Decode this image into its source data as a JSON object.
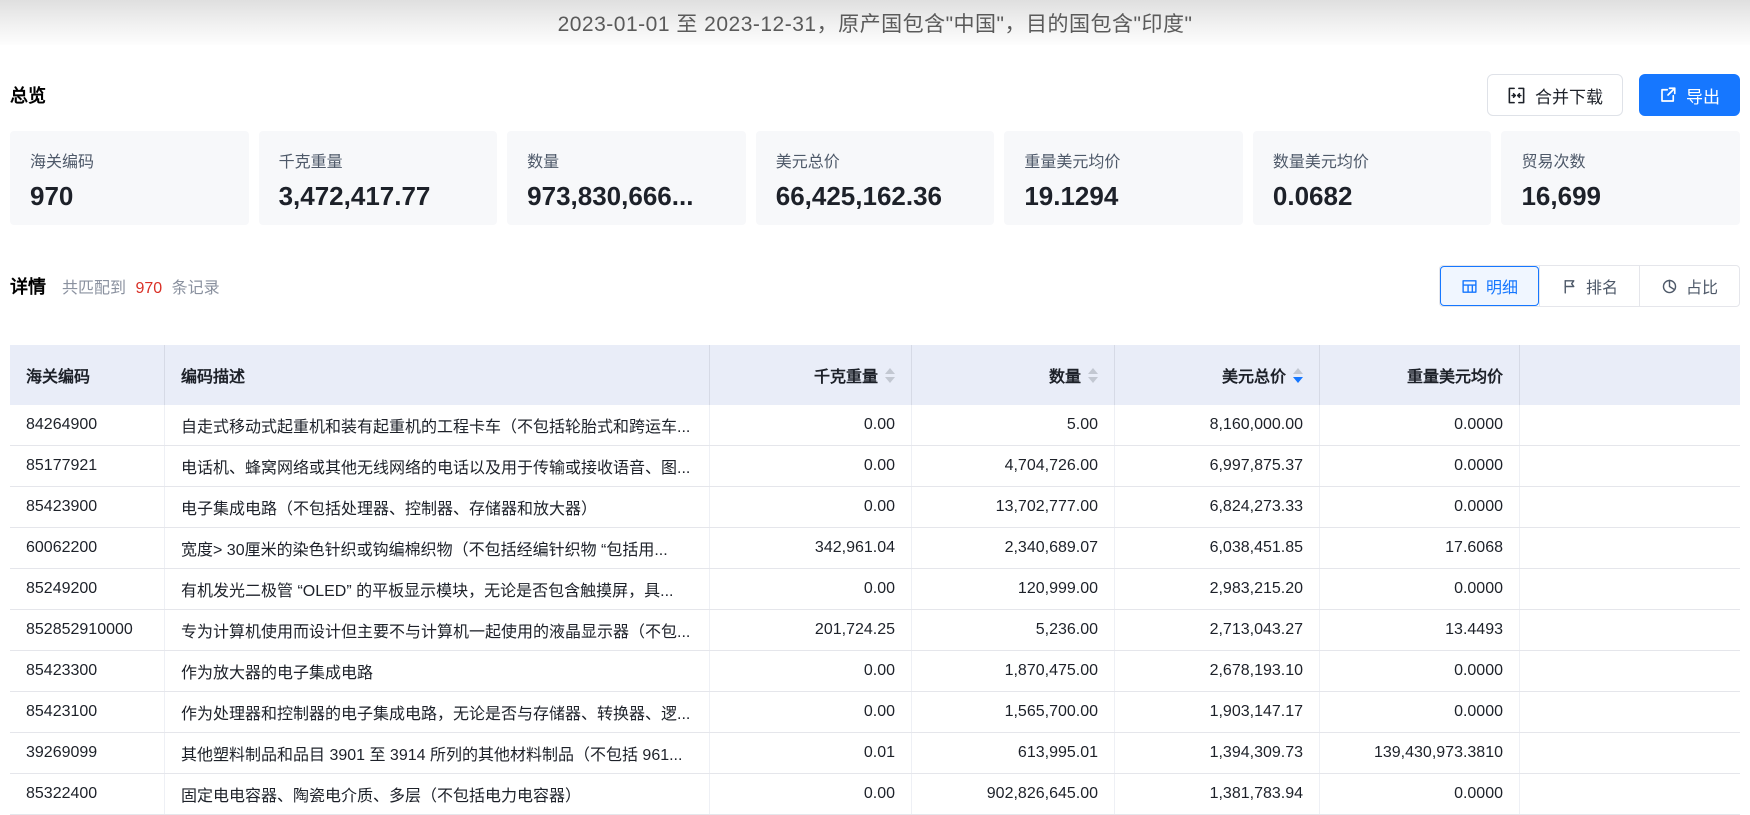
{
  "colors": {
    "accent": "#1677ff",
    "red": "#d93026",
    "table_header_bg": "#e9edf8",
    "card_bg": "#f7f8fa"
  },
  "header": {
    "title": "2023-01-01 至 2023-12-31，原产国包含\"中国\"，目的国包含\"印度\""
  },
  "overview": {
    "section_title": "总览",
    "merge_download_label": "合并下载",
    "export_label": "导出",
    "cards": [
      {
        "label": "海关编码",
        "value": "970"
      },
      {
        "label": "千克重量",
        "value": "3,472,417.77"
      },
      {
        "label": "数量",
        "value": "973,830,666..."
      },
      {
        "label": "美元总价",
        "value": "66,425,162.36"
      },
      {
        "label": "重量美元均价",
        "value": "19.1294"
      },
      {
        "label": "数量美元均价",
        "value": "0.0682"
      },
      {
        "label": "贸易次数",
        "value": "16,699"
      }
    ]
  },
  "detail": {
    "section_title": "详情",
    "match_prefix": "共匹配到",
    "match_count": "970",
    "match_suffix": "条记录",
    "tabs": [
      {
        "id": "detail",
        "label": "明细",
        "icon": "table-icon",
        "active": true
      },
      {
        "id": "ranking",
        "label": "排名",
        "icon": "rank-flag-icon",
        "active": false
      },
      {
        "id": "proportion",
        "label": "占比",
        "icon": "pie-chart-icon",
        "active": false
      }
    ]
  },
  "table": {
    "columns": [
      {
        "key": "hs_code",
        "label": "海关编码",
        "align": "left",
        "sortable": false,
        "sort": ""
      },
      {
        "key": "description",
        "label": "编码描述",
        "align": "left",
        "sortable": false,
        "sort": ""
      },
      {
        "key": "kg_weight",
        "label": "千克重量",
        "align": "right",
        "sortable": true,
        "sort": ""
      },
      {
        "key": "quantity",
        "label": "数量",
        "align": "right",
        "sortable": true,
        "sort": ""
      },
      {
        "key": "usd_total",
        "label": "美元总价",
        "align": "right",
        "sortable": true,
        "sort": "desc"
      },
      {
        "key": "usd_per_kg",
        "label": "重量美元均价",
        "align": "right",
        "sortable": false,
        "sort": ""
      }
    ],
    "rows": [
      {
        "hs_code": "84264900",
        "description": "自走式移动式起重机和装有起重机的工程卡车（不包括轮胎式和跨运车...",
        "kg_weight": "0.00",
        "quantity": "5.00",
        "usd_total": "8,160,000.00",
        "usd_per_kg": "0.0000"
      },
      {
        "hs_code": "85177921",
        "description": "电话机、蜂窝网络或其他无线网络的电话以及用于传输或接收语音、图...",
        "kg_weight": "0.00",
        "quantity": "4,704,726.00",
        "usd_total": "6,997,875.37",
        "usd_per_kg": "0.0000"
      },
      {
        "hs_code": "85423900",
        "description": "电子集成电路（不包括处理器、控制器、存储器和放大器）",
        "kg_weight": "0.00",
        "quantity": "13,702,777.00",
        "usd_total": "6,824,273.33",
        "usd_per_kg": "0.0000"
      },
      {
        "hs_code": "60062200",
        "description": "宽度> 30厘米的染色针织或钩编棉织物（不包括经编针织物 “包括用...",
        "kg_weight": "342,961.04",
        "quantity": "2,340,689.07",
        "usd_total": "6,038,451.85",
        "usd_per_kg": "17.6068"
      },
      {
        "hs_code": "85249200",
        "description": "有机发光二极管 “OLED” 的平板显示模块，无论是否包含触摸屏，具...",
        "kg_weight": "0.00",
        "quantity": "120,999.00",
        "usd_total": "2,983,215.20",
        "usd_per_kg": "0.0000"
      },
      {
        "hs_code": "852852910000",
        "description": "专为计算机使用而设计但主要不与计算机一起使用的液晶显示器（不包...",
        "kg_weight": "201,724.25",
        "quantity": "5,236.00",
        "usd_total": "2,713,043.27",
        "usd_per_kg": "13.4493"
      },
      {
        "hs_code": "85423300",
        "description": "作为放大器的电子集成电路",
        "kg_weight": "0.00",
        "quantity": "1,870,475.00",
        "usd_total": "2,678,193.10",
        "usd_per_kg": "0.0000"
      },
      {
        "hs_code": "85423100",
        "description": "作为处理器和控制器的电子集成电路，无论是否与存储器、转换器、逻...",
        "kg_weight": "0.00",
        "quantity": "1,565,700.00",
        "usd_total": "1,903,147.17",
        "usd_per_kg": "0.0000"
      },
      {
        "hs_code": "39269099",
        "description": "其他塑料制品和品目 3901 至 3914 所列的其他材料制品（不包括 961...",
        "kg_weight": "0.01",
        "quantity": "613,995.01",
        "usd_total": "1,394,309.73",
        "usd_per_kg": "139,430,973.3810"
      },
      {
        "hs_code": "85322400",
        "description": "固定电电容器、陶瓷电介质、多层（不包括电力电容器）",
        "kg_weight": "0.00",
        "quantity": "902,826,645.00",
        "usd_total": "1,381,783.94",
        "usd_per_kg": "0.0000"
      }
    ]
  }
}
